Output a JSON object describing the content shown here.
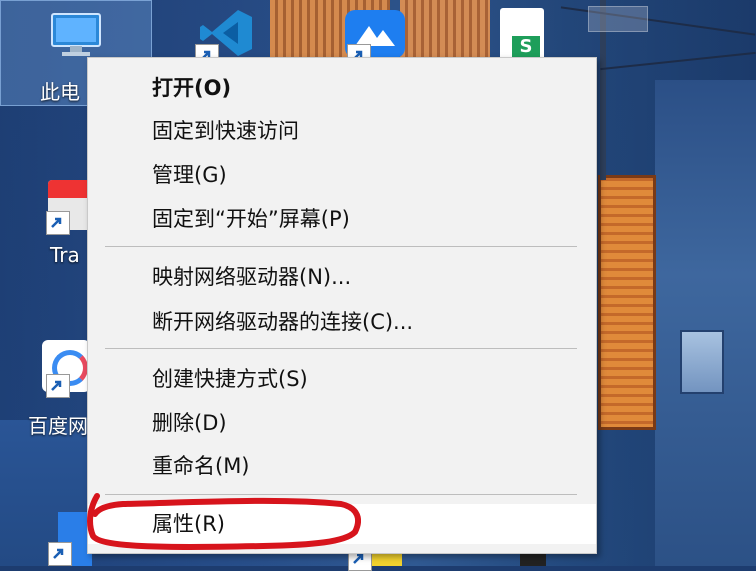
{
  "desktop": {
    "icons": [
      {
        "label": "此电",
        "icon": "computer-icon"
      },
      {
        "label": "Tra",
        "icon": "app-shortcut-icon"
      },
      {
        "label": "百度网",
        "icon": "baidu-netdisk-icon"
      }
    ],
    "top_icons": [
      "vscode-icon",
      "feishu-icon",
      "sheets-icon"
    ],
    "bottom_icons": [
      "player-icon"
    ]
  },
  "context_menu": {
    "items": [
      {
        "label": "打开(O)",
        "bold": true
      },
      {
        "label": "固定到快速访问"
      },
      {
        "label": "管理(G)"
      },
      {
        "label": "固定到“开始”屏幕(P)"
      },
      {
        "label": "映射网络驱动器(N)..."
      },
      {
        "label": "断开网络驱动器的连接(C)..."
      },
      {
        "label": "创建快捷方式(S)"
      },
      {
        "label": "删除(D)"
      },
      {
        "label": "重命名(M)"
      },
      {
        "label": "属性(R)",
        "hovered": true
      }
    ]
  },
  "annotation": {
    "color": "#d7141c",
    "target": "属性(R)"
  },
  "colors": {
    "menu_bg": "#f2f2f2",
    "separator": "#bdbdbd",
    "highlight": "#d7141c"
  }
}
